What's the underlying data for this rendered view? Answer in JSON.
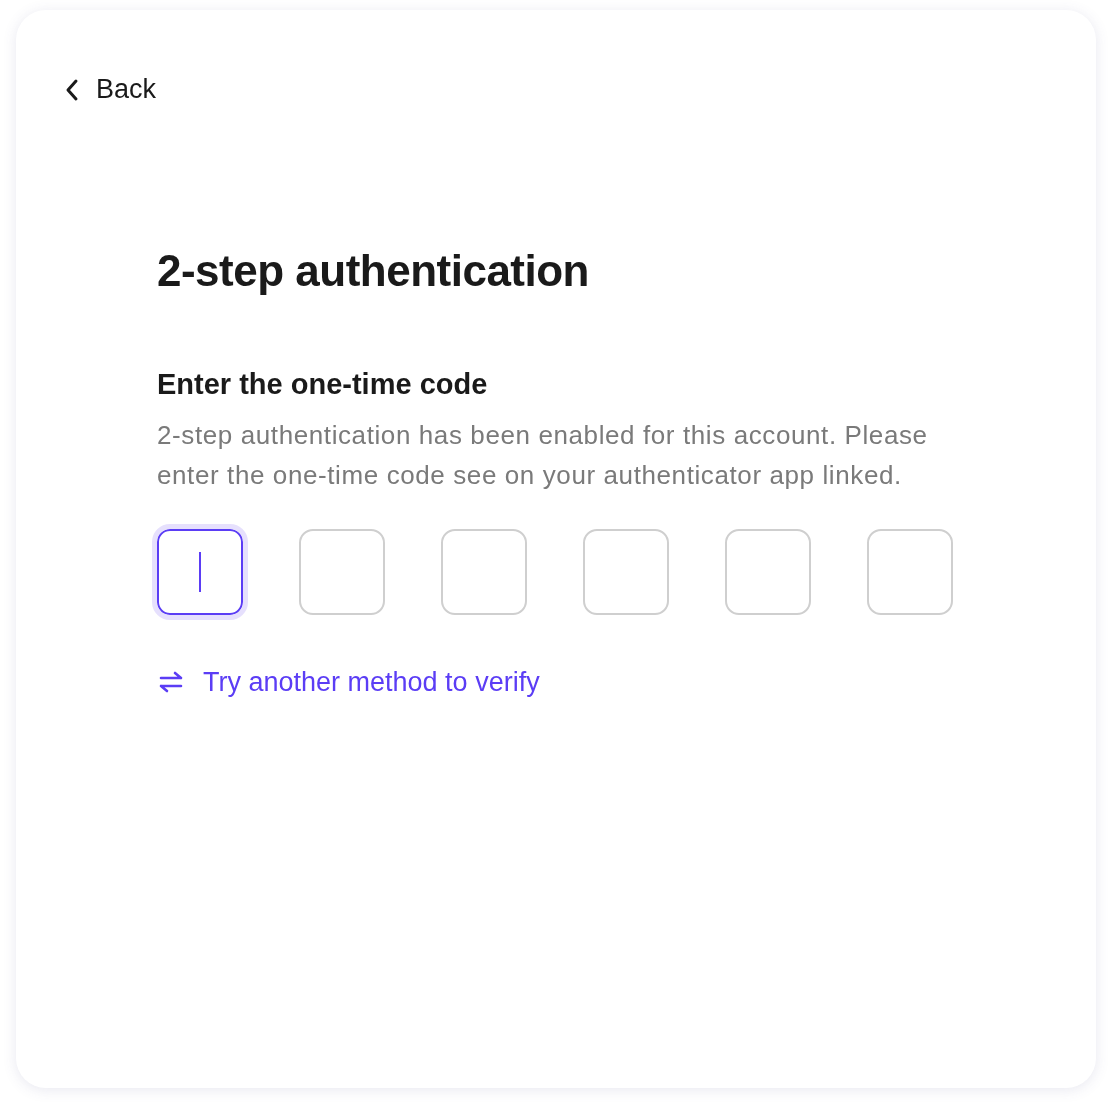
{
  "back_link": {
    "label": "Back"
  },
  "title": "2-step authentication",
  "subtitle": "Enter the one-time code",
  "description": "2-step authentication has been enabled for this account. Please enter the one-time code see on your authenticator app linked.",
  "code_inputs": [
    {
      "focused": true
    },
    {
      "focused": false
    },
    {
      "focused": false
    },
    {
      "focused": false
    },
    {
      "focused": false
    },
    {
      "focused": false
    }
  ],
  "alternate_link": {
    "label": "Try another method to verify"
  }
}
